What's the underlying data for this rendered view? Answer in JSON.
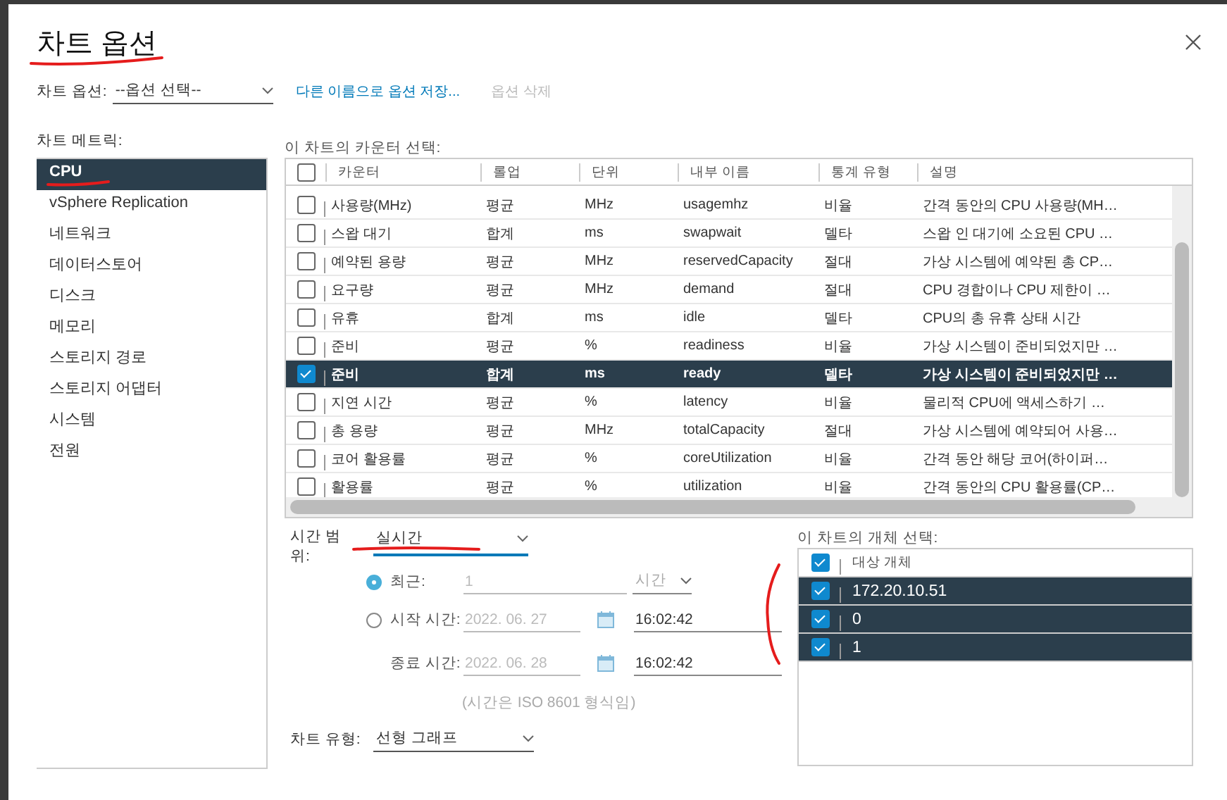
{
  "dialog": {
    "title": "차트 옵션"
  },
  "chart_options": {
    "label": "차트 옵션:",
    "value": "--옵션 선택--"
  },
  "save_as_link": "다른 이름으로 옵션 저장...",
  "delete_option": {
    "label": "옵션 삭제",
    "disabled": true
  },
  "metrics": {
    "label": "차트 메트릭:",
    "items": [
      {
        "label": "CPU",
        "selected": true
      },
      {
        "label": "vSphere Replication",
        "selected": false
      },
      {
        "label": "네트워크",
        "selected": false
      },
      {
        "label": "데이터스토어",
        "selected": false
      },
      {
        "label": "디스크",
        "selected": false
      },
      {
        "label": "메모리",
        "selected": false
      },
      {
        "label": "스토리지 경로",
        "selected": false
      },
      {
        "label": "스토리지 어댑터",
        "selected": false
      },
      {
        "label": "시스템",
        "selected": false
      },
      {
        "label": "전원",
        "selected": false
      }
    ]
  },
  "counters": {
    "label": "이 차트의 카운터 선택:",
    "all_checked": false,
    "columns": [
      "카운터",
      "롤업",
      "단위",
      "내부 이름",
      "통계 유형",
      "설명"
    ],
    "rows": [
      {
        "cells": [
          "사용량(MHz)",
          "평균",
          "MHz",
          "usagemhz",
          "비율",
          "간격 동안의 CPU 사용량(MH…"
        ],
        "checked": false,
        "selected": false
      },
      {
        "cells": [
          "스왑 대기",
          "합계",
          "ms",
          "swapwait",
          "델타",
          "스왑 인 대기에 소요된 CPU …"
        ],
        "checked": false,
        "selected": false
      },
      {
        "cells": [
          "예약된 용량",
          "평균",
          "MHz",
          "reservedCapacity",
          "절대",
          "가상 시스템에 예약된 총 CP…"
        ],
        "checked": false,
        "selected": false
      },
      {
        "cells": [
          "요구량",
          "평균",
          "MHz",
          "demand",
          "절대",
          "CPU 경합이나 CPU 제한이 …"
        ],
        "checked": false,
        "selected": false
      },
      {
        "cells": [
          "유휴",
          "합계",
          "ms",
          "idle",
          "델타",
          "CPU의 총 유휴 상태 시간"
        ],
        "checked": false,
        "selected": false
      },
      {
        "cells": [
          "준비",
          "평균",
          "%",
          "readiness",
          "비율",
          "가상 시스템이 준비되었지만 …"
        ],
        "checked": false,
        "selected": false
      },
      {
        "cells": [
          "준비",
          "합계",
          "ms",
          "ready",
          "델타",
          "가상 시스템이 준비되었지만 …"
        ],
        "checked": true,
        "selected": true
      },
      {
        "cells": [
          "지연 시간",
          "평균",
          "%",
          "latency",
          "비율",
          "물리적 CPU에 액세스하기 …"
        ],
        "checked": false,
        "selected": false
      },
      {
        "cells": [
          "총 용량",
          "평균",
          "MHz",
          "totalCapacity",
          "절대",
          "가상 시스템에 예약되어 사용…"
        ],
        "checked": false,
        "selected": false
      },
      {
        "cells": [
          "코어 활용률",
          "평균",
          "%",
          "coreUtilization",
          "비율",
          "간격 동안 해당 코어(하이퍼…"
        ],
        "checked": false,
        "selected": false
      },
      {
        "cells": [
          "활용률",
          "평균",
          "%",
          "utilization",
          "비율",
          "간격 동안의 CPU 활용률(CP…"
        ],
        "checked": false,
        "selected": false
      }
    ]
  },
  "time_range": {
    "label": "시간 범위:",
    "value": "실시간",
    "options": [
      {
        "label": "최근:",
        "selected": true,
        "value": {
          "text": "1",
          "disabled": true
        },
        "unit": "시간"
      },
      {
        "label": "시작 시간:",
        "selected": false,
        "date": {
          "text": "2022. 06. 27",
          "disabled": true
        },
        "time": {
          "text": "16:02:42",
          "disabled": false
        }
      }
    ],
    "end": {
      "label": "종료 시간:",
      "date": {
        "text": "2022. 06. 28",
        "disabled": true
      },
      "time": {
        "text": "16:02:42",
        "disabled": false
      }
    },
    "note": "(시간은 ISO 8601 형식임)"
  },
  "chart_type": {
    "label": "차트 유형:",
    "value": "선형 그래프"
  },
  "objects": {
    "label": "이 차트의 개체 선택:",
    "header": "대상 개체",
    "all_checked": true,
    "rows": [
      {
        "label": "172.20.10.51",
        "checked": true,
        "selected": true
      },
      {
        "label": "0",
        "checked": true,
        "selected": true
      },
      {
        "label": "1",
        "checked": true,
        "selected": true
      }
    ]
  },
  "pen_marks": [
    {
      "kind": "underline"
    },
    {
      "kind": "underline"
    },
    {
      "kind": "underline"
    },
    {
      "kind": "bracket"
    }
  ]
}
